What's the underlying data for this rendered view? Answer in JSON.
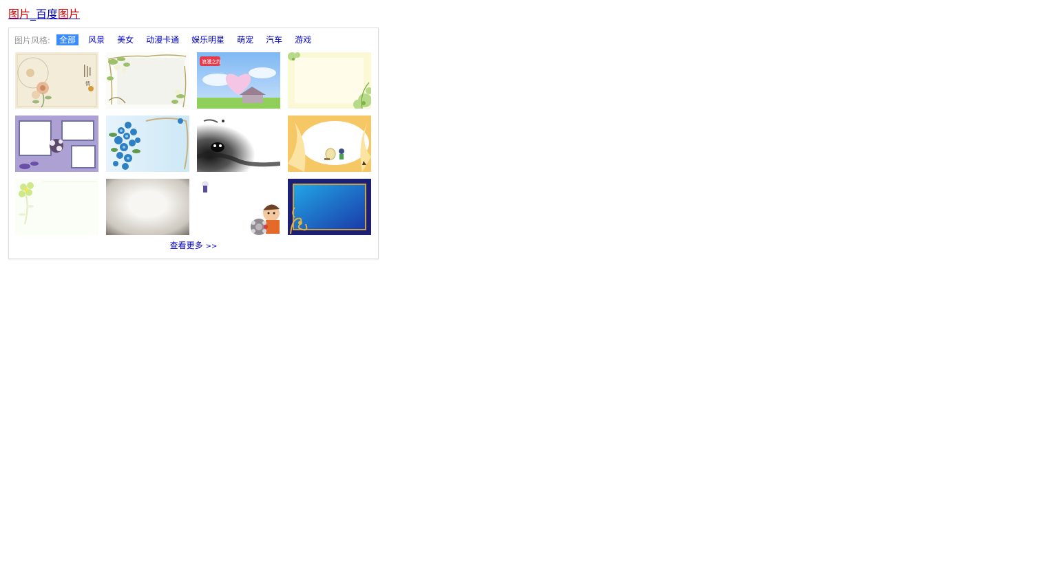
{
  "result": {
    "title_part1": "图片",
    "title_part2": "_百度",
    "title_part3": "图片"
  },
  "filter": {
    "label": "图片风格:",
    "tabs": [
      "全部",
      "风景",
      "美女",
      "动漫卡通",
      "娱乐明星",
      "萌宠",
      "汽车",
      "游戏"
    ],
    "active_index": 0
  },
  "thumbnails": [
    {
      "kind": "floral-beige"
    },
    {
      "kind": "vine-frame"
    },
    {
      "kind": "heart-sky",
      "badge": "浪漫之约"
    },
    {
      "kind": "yellow-green"
    },
    {
      "kind": "purple-photo-frames"
    },
    {
      "kind": "blue-flowers"
    },
    {
      "kind": "ink-wash"
    },
    {
      "kind": "gold-cartoon"
    },
    {
      "kind": "light-flower"
    },
    {
      "kind": "vignette"
    },
    {
      "kind": "cartoon-kid"
    },
    {
      "kind": "blue-gold-frame"
    }
  ],
  "more": {
    "label": "查看更多",
    "arrow": ">>"
  },
  "colors": {
    "link": "#0000cc",
    "highlight": "#cc0000",
    "active_tab_bg": "#388bff"
  }
}
